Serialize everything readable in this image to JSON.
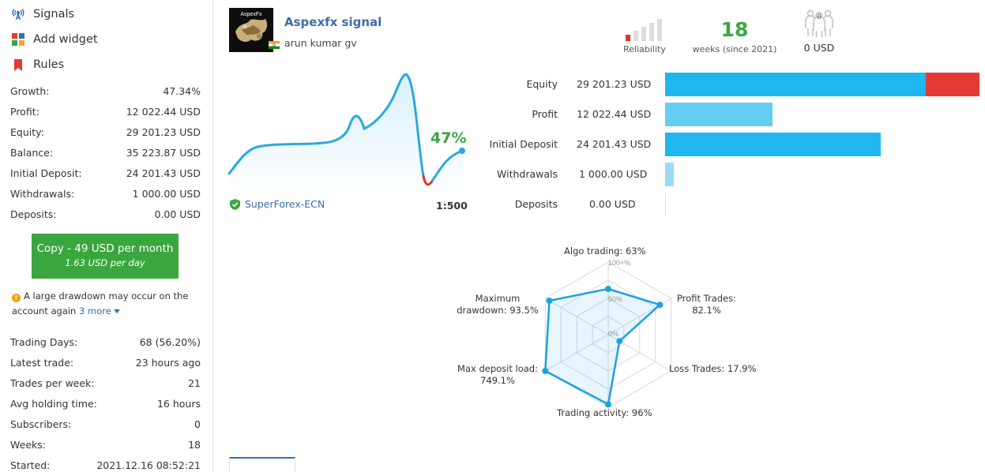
{
  "sidebar": {
    "nav": [
      {
        "label": "Signals",
        "icon": "antenna-icon"
      },
      {
        "label": "Add widget",
        "icon": "widget-icon"
      },
      {
        "label": "Rules",
        "icon": "bookmark-icon"
      }
    ],
    "stats": [
      {
        "label": "Growth:",
        "value": "47.34%"
      },
      {
        "label": "Profit:",
        "value": "12 022.44 USD"
      },
      {
        "label": "Equity:",
        "value": "29 201.23 USD"
      },
      {
        "label": "Balance:",
        "value": "35 223.87 USD"
      },
      {
        "label": "Initial Deposit:",
        "value": "24 201.43 USD"
      },
      {
        "label": "Withdrawals:",
        "value": "1 000.00 USD"
      },
      {
        "label": "Deposits:",
        "value": "0.00 USD"
      }
    ],
    "copy_button": {
      "label": "Copy - 49 USD per month",
      "sub": "1.63 USD per day",
      "color": "#3aa63f"
    },
    "warning": {
      "text": "A large drawdown may occur on the account again",
      "more": "3 more"
    },
    "stats2": [
      {
        "label": "Trading Days:",
        "value": "68 (56.20%)"
      },
      {
        "label": "Latest trade:",
        "value": "23 hours ago"
      },
      {
        "label": "Trades per week:",
        "value": "21"
      },
      {
        "label": "Avg holding time:",
        "value": "16 hours"
      },
      {
        "label": "Subscribers:",
        "value": "0"
      },
      {
        "label": "Weeks:",
        "value": "18"
      },
      {
        "label": "Started:",
        "value": "2021.12.16 08:52:21"
      }
    ]
  },
  "header": {
    "signal_name": "Aspexfx signal",
    "author": "arun kumar gv",
    "avatar_text": "AspexFx",
    "reliability_label": "Reliability",
    "reliability_level": 1,
    "weeks_value": "18",
    "weeks_label": "weeks (since 2021)",
    "subscribers_count": "0",
    "subscribers_funds": "0 USD"
  },
  "growth": {
    "percent_label": "47%",
    "broker": "SuperForex-ECN",
    "leverage": "1:500",
    "line_color": "#2aa9e0",
    "drawdown_color": "#e0332a"
  },
  "bars": {
    "items": [
      {
        "label": "Equity",
        "value": "29 201.23 USD",
        "amount": 29201.23,
        "loss": 6022.64,
        "color": "#1fb7ef"
      },
      {
        "label": "Profit",
        "value": "12 022.44 USD",
        "amount": 12022.44,
        "color": "#66cdf2"
      },
      {
        "label": "Initial Deposit",
        "value": "24 201.43 USD",
        "amount": 24201.43,
        "color": "#1fb7ef"
      },
      {
        "label": "Withdrawals",
        "value": "1 000.00 USD",
        "amount": 1000.0,
        "color": "#99dcf5"
      },
      {
        "label": "Deposits",
        "value": "0.00 USD",
        "amount": 0,
        "color": "#c8ecf9"
      }
    ],
    "loss_color": "#e53935"
  },
  "radar": {
    "scale_labels": [
      "100+%",
      "50%",
      "0%"
    ],
    "axes": [
      {
        "label": "Algo trading: 63%",
        "pct": 63
      },
      {
        "label": "Profit Trades: 82.1%",
        "pct": 82.1
      },
      {
        "label": "Loss Trades: 17.9%",
        "pct": 17.9
      },
      {
        "label": "Trading activity: 96%",
        "pct": 96
      },
      {
        "label": "Max deposit load: 749.1%",
        "pct": 100
      },
      {
        "label": "Maximum drawdown: 93.5%",
        "pct": 93.5
      }
    ],
    "color": "#1da1e2"
  }
}
